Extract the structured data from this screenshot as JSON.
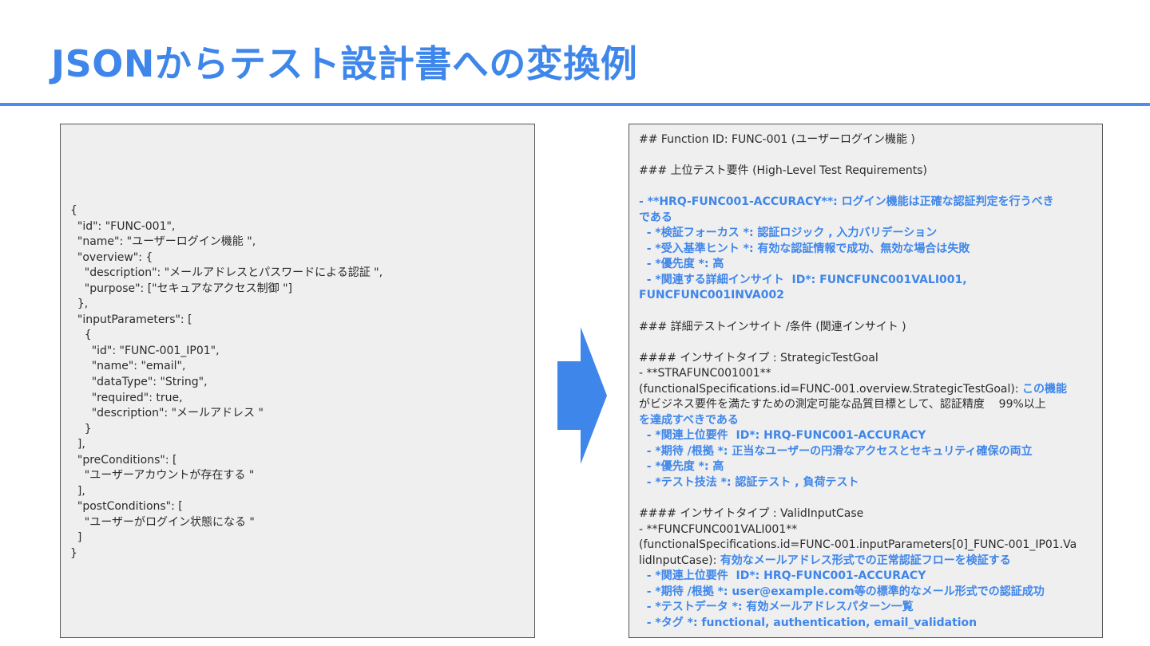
{
  "title": "JSONからテスト設計書への変換例",
  "json_lines": [
    "{",
    "  \"id\": \"FUNC-001\",",
    "  \"name\": \"ユーザーログイン機能 \",",
    "  \"overview\": {",
    "    \"description\": \"メールアドレスとパスワードによる認証 \",",
    "    \"purpose\": [\"セキュアなアクセス制御 \"]",
    "  },",
    "  \"inputParameters\": [",
    "    {",
    "      \"id\": \"FUNC-001_IP01\",",
    "      \"name\": \"email\",",
    "      \"dataType\": \"String\",",
    "      \"required\": true,",
    "      \"description\": \"メールアドレス \"",
    "    }",
    "  ],",
    "  \"preConditions\": [",
    "    \"ユーザーアカウントが存在する \"",
    "  ],",
    "  \"postConditions\": [",
    "    \"ユーザーがログイン状態になる \"",
    "  ]",
    "}"
  ],
  "md_lines": [
    "## Function ID: FUNC-001 (ユーザーログイン機能 )",
    "",
    "### 上位テスト要件 (High-Level Test Requirements)",
    "",
    "- **HRQ-FUNC001-ACCURACY**: ログイン機能は正確な認証判定を行うべき",
    "である",
    "  - *検証フォーカス *: 認証ロジック , 入力バリデーション",
    "  - *受入基準ヒント *: 有効な認証情報で成功、無効な場合は失敗",
    "  - *優先度 *: 高",
    "  - *関連する詳細インサイト  ID*: FUNCFUNC001VALI001,",
    "FUNCFUNC001INVA002",
    "",
    "### 詳細テストインサイト /条件 (関連インサイト )",
    "",
    "#### インサイトタイプ : StrategicTestGoal",
    "- **STRAFUNC001001**",
    "(functionalSpecifications.id=FUNC-001.overview.StrategicTestGoal): ",
    "この機能",
    "がビジネス要件を満たすための測定可能な品質目標として、認証精度    99%以上",
    "を達成すべきである",
    "  - *関連上位要件  ID*: HRQ-FUNC001-ACCURACY",
    "  - *期待 /根拠 *: 正当なユーザーの円滑なアクセスとセキュリティ確保の両立",
    "  - *優先度 *: 高",
    "  - *テスト技法 *: 認証テスト , 負荷テスト",
    "",
    "#### インサイトタイプ : ValidInputCase",
    "- **FUNCFUNC001VALI001**",
    "(functionalSpecifications.id=FUNC-001.inputParameters[0]_FUNC-001_IP01.Va",
    "lidInputCase): ",
    "有効なメールアドレス形式での正常認証フローを検証する",
    "  - *関連上位要件  ID*: HRQ-FUNC001-ACCURACY",
    "  - *期待 /根拠 *: user@example.com等の標準的なメール形式での認証成功",
    "  - *テストデータ *: 有効メールアドレスパターン一覧",
    "  - *タグ *: functional, authentication, email_validation"
  ],
  "colors": {
    "accent": "#3f86ea",
    "panel_bg": "#efefef",
    "panel_border": "#555555",
    "text": "#2b2b2b"
  },
  "icons": {
    "arrow": "right-arrow-icon"
  }
}
